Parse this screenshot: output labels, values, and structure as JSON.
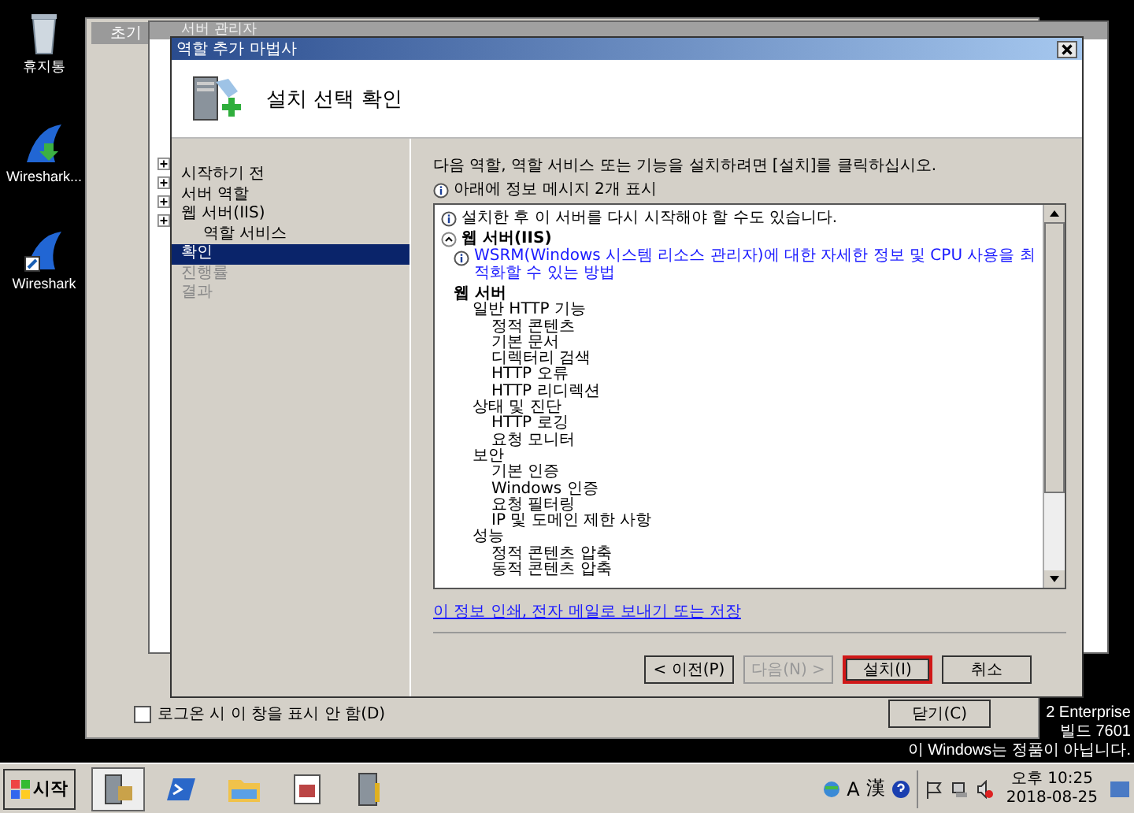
{
  "desktop_icons": [
    {
      "kind": "bin",
      "label": "휴지통"
    },
    {
      "kind": "download",
      "label": "Wireshark..."
    },
    {
      "kind": "shark",
      "label": "Wireshark"
    }
  ],
  "background_window": {
    "title": "초기",
    "checkbox": {
      "label": "로그온 시 이 창을 표시 안 함(D)",
      "checked": false
    },
    "close_button": "닫기(C)"
  },
  "server_manager": {
    "title": "서버 관리자"
  },
  "wizard": {
    "title": "역할 추가 마법사",
    "heading": "설치 선택 확인",
    "nav": [
      {
        "label": "시작하기 전",
        "selected": false,
        "disabled": false
      },
      {
        "label": "서버 역할",
        "selected": false,
        "disabled": false
      },
      {
        "label": "웹 서버(IIS)",
        "selected": false,
        "disabled": false,
        "children": [
          {
            "label": "역할 서비스",
            "selected": false,
            "disabled": false
          }
        ]
      },
      {
        "label": "확인",
        "selected": true,
        "disabled": false
      },
      {
        "label": "진행률",
        "selected": false,
        "disabled": true
      },
      {
        "label": "결과",
        "selected": false,
        "disabled": true
      }
    ],
    "instruction": "다음 역할, 역할 서비스 또는 기능을 설치하려면 [설치]를 클릭하십시오.",
    "info_count": "아래에 정보 메시지 2개 표시",
    "restart_note": "설치한 후 이 서버를 다시 시작해야 할 수도 있습니다.",
    "section": {
      "title": "웹 서버(IIS)",
      "expanded": true
    },
    "wsrm_link": "WSRM(Windows 시스템 리소스 관리자)에 대한 자세한 정보 및 CPU 사용을 최적화할 수 있는 방법",
    "tree": [
      {
        "label": "웹 서버",
        "children": [
          {
            "label": "일반 HTTP 기능",
            "children": [
              {
                "label": "정적 콘텐츠"
              },
              {
                "label": "기본 문서"
              },
              {
                "label": "디렉터리 검색"
              },
              {
                "label": "HTTP 오류"
              },
              {
                "label": "HTTP 리디렉션"
              }
            ]
          },
          {
            "label": "상태 및 진단",
            "children": [
              {
                "label": "HTTP 로깅"
              },
              {
                "label": "요청 모니터"
              }
            ]
          },
          {
            "label": "보안",
            "children": [
              {
                "label": "기본 인증"
              },
              {
                "label": "Windows 인증"
              },
              {
                "label": "요청 필터링"
              },
              {
                "label": "IP 및 도메인 제한 사항"
              }
            ]
          },
          {
            "label": "성능",
            "children": [
              {
                "label": "정적 콘텐츠 압축"
              },
              {
                "label": "동적 콘텐츠 압축"
              }
            ]
          }
        ]
      }
    ],
    "print_link": "이 정보 인쇄, 전자 메일로 보내기 또는 저장",
    "buttons": [
      {
        "label": "< 이전(P)",
        "disabled": false,
        "highlighted": false
      },
      {
        "label": "다음(N) >",
        "disabled": true,
        "highlighted": false
      },
      {
        "label": "설치(I)",
        "disabled": false,
        "highlighted": true
      },
      {
        "label": "취소",
        "disabled": false,
        "highlighted": false
      }
    ]
  },
  "os_notice": [
    "2 Enterprise",
    "빌드 7601",
    "이 Windows는 정품이 아닙니다."
  ],
  "taskbar": {
    "start": "시작",
    "apps": [
      {
        "kind": "server",
        "selected": true
      },
      {
        "kind": "shell",
        "selected": false
      },
      {
        "kind": "folder",
        "selected": false
      },
      {
        "kind": "calendar",
        "selected": false
      },
      {
        "kind": "tools",
        "selected": false
      }
    ],
    "ime": [
      "A",
      "漢"
    ],
    "time": "오후 10:25",
    "date": "2018-08-25"
  }
}
